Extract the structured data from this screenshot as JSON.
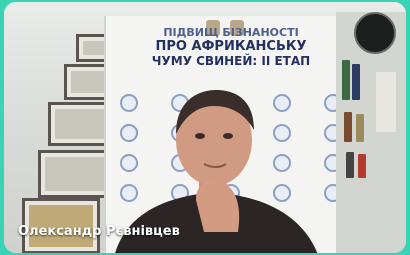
{
  "participant": {
    "name": "Олександр Рєвнівцев"
  },
  "banner": {
    "line1": "ПІДВИЩ   БІЗНАНОСТІ",
    "line2": "ПРО АФРИКАНСЬКУ",
    "line3": "ЧУМУ СВИНЕЙ: ІІ ЕТАП"
  },
  "colors": {
    "background": "#3bd3b5",
    "banner_text": "#24305e"
  }
}
